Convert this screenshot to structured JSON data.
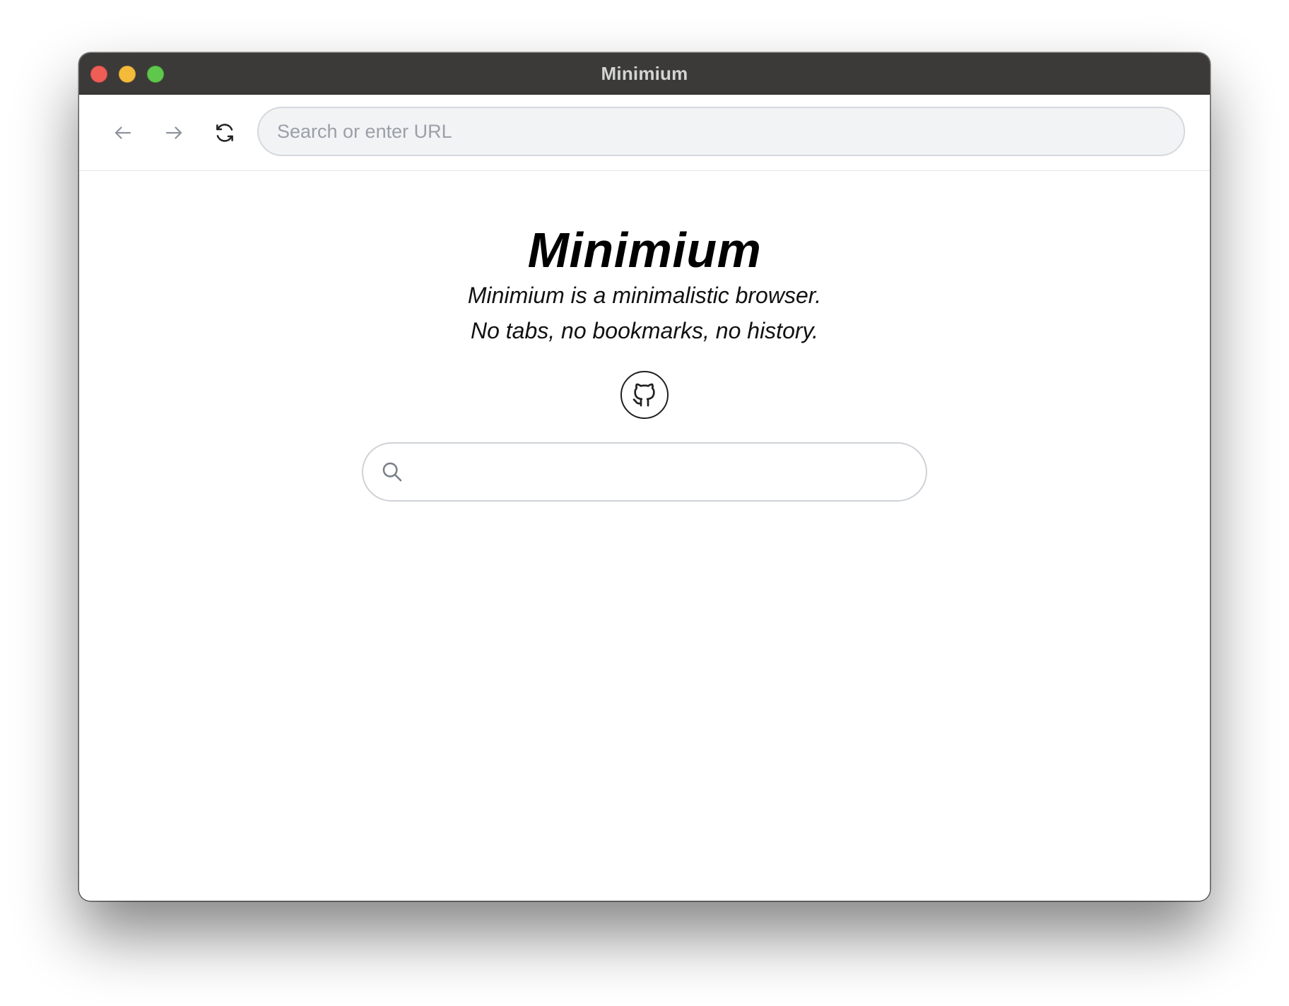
{
  "window": {
    "title": "Minimium"
  },
  "toolbar": {
    "back_icon": "arrow-left-icon",
    "forward_icon": "arrow-right-icon",
    "reload_icon": "refresh-icon",
    "url_placeholder": "Search or enter URL",
    "url_value": ""
  },
  "home": {
    "title": "Minimium",
    "tagline_1": "Minimium is a minimalistic browser.",
    "tagline_2": "No tabs, no bookmarks, no history.",
    "github_icon": "github-icon",
    "search_icon": "search-icon",
    "search_placeholder": "",
    "search_value": ""
  },
  "colors": {
    "titlebar": "#3b3a39",
    "close": "#ee5e57",
    "minimize": "#f4bb3b",
    "maximize": "#5fc74c",
    "url_bar_bg": "#f2f3f5",
    "placeholder": "#9aa0a8"
  }
}
